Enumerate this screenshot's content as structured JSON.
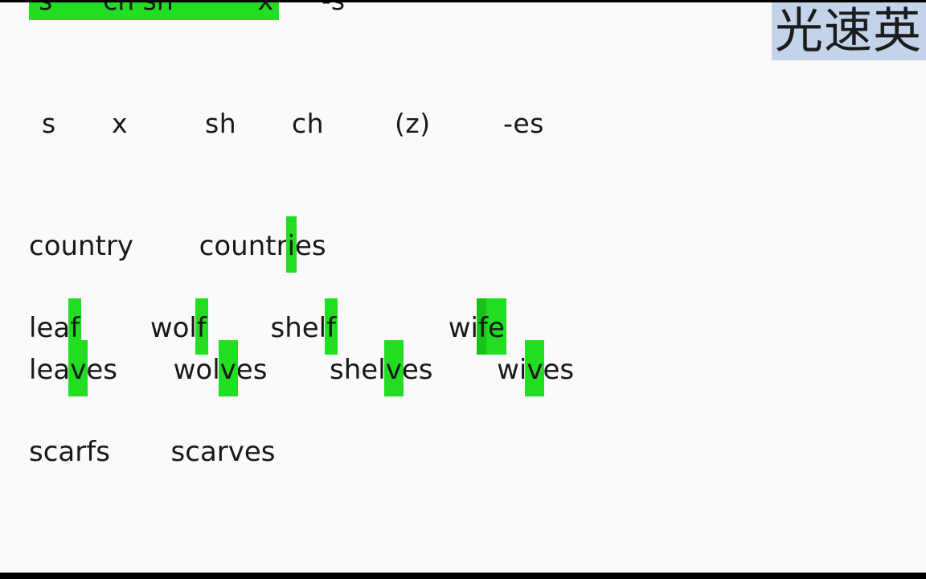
{
  "slide": {
    "background_color": "#fafafa",
    "highlight_color": "#22dd22",
    "highlight_color_dark": "#19c219",
    "text_color": "#181818",
    "letterbox_color": "#000000"
  },
  "watermark": {
    "text": "光速英",
    "background_color": "#c3d4ea"
  },
  "top_rule": {
    "text": "s      ch sh          x",
    "suffix": "-s",
    "highlight_color": "#22dd22"
  },
  "endings_row": {
    "items": [
      "s",
      "x",
      "sh",
      "ch",
      "(z)",
      "-es"
    ]
  },
  "country_row": {
    "singular": "country",
    "plural_before": "countr",
    "plural_highlight": "i",
    "plural_after": "es"
  },
  "f_singular_row": {
    "words": [
      {
        "before": "lea",
        "highlight": "f",
        "after": ""
      },
      {
        "before": "wol",
        "highlight": "f",
        "after": ""
      },
      {
        "before": "shel",
        "highlight": "f",
        "after": ""
      },
      {
        "before": "wi",
        "highlight": "f",
        "highlight2": "e",
        "after": ""
      }
    ]
  },
  "f_plural_row": {
    "words": [
      {
        "before": "lea",
        "highlight": "v",
        "after": "es"
      },
      {
        "before": "wol",
        "highlight": "v",
        "after": "es"
      },
      {
        "before": "shel",
        "highlight": "v",
        "after": "es"
      },
      {
        "before": "wi",
        "highlight": "v",
        "after": "es"
      }
    ]
  },
  "scarf_row": {
    "singular": "scarfs",
    "plural": "scarves"
  }
}
